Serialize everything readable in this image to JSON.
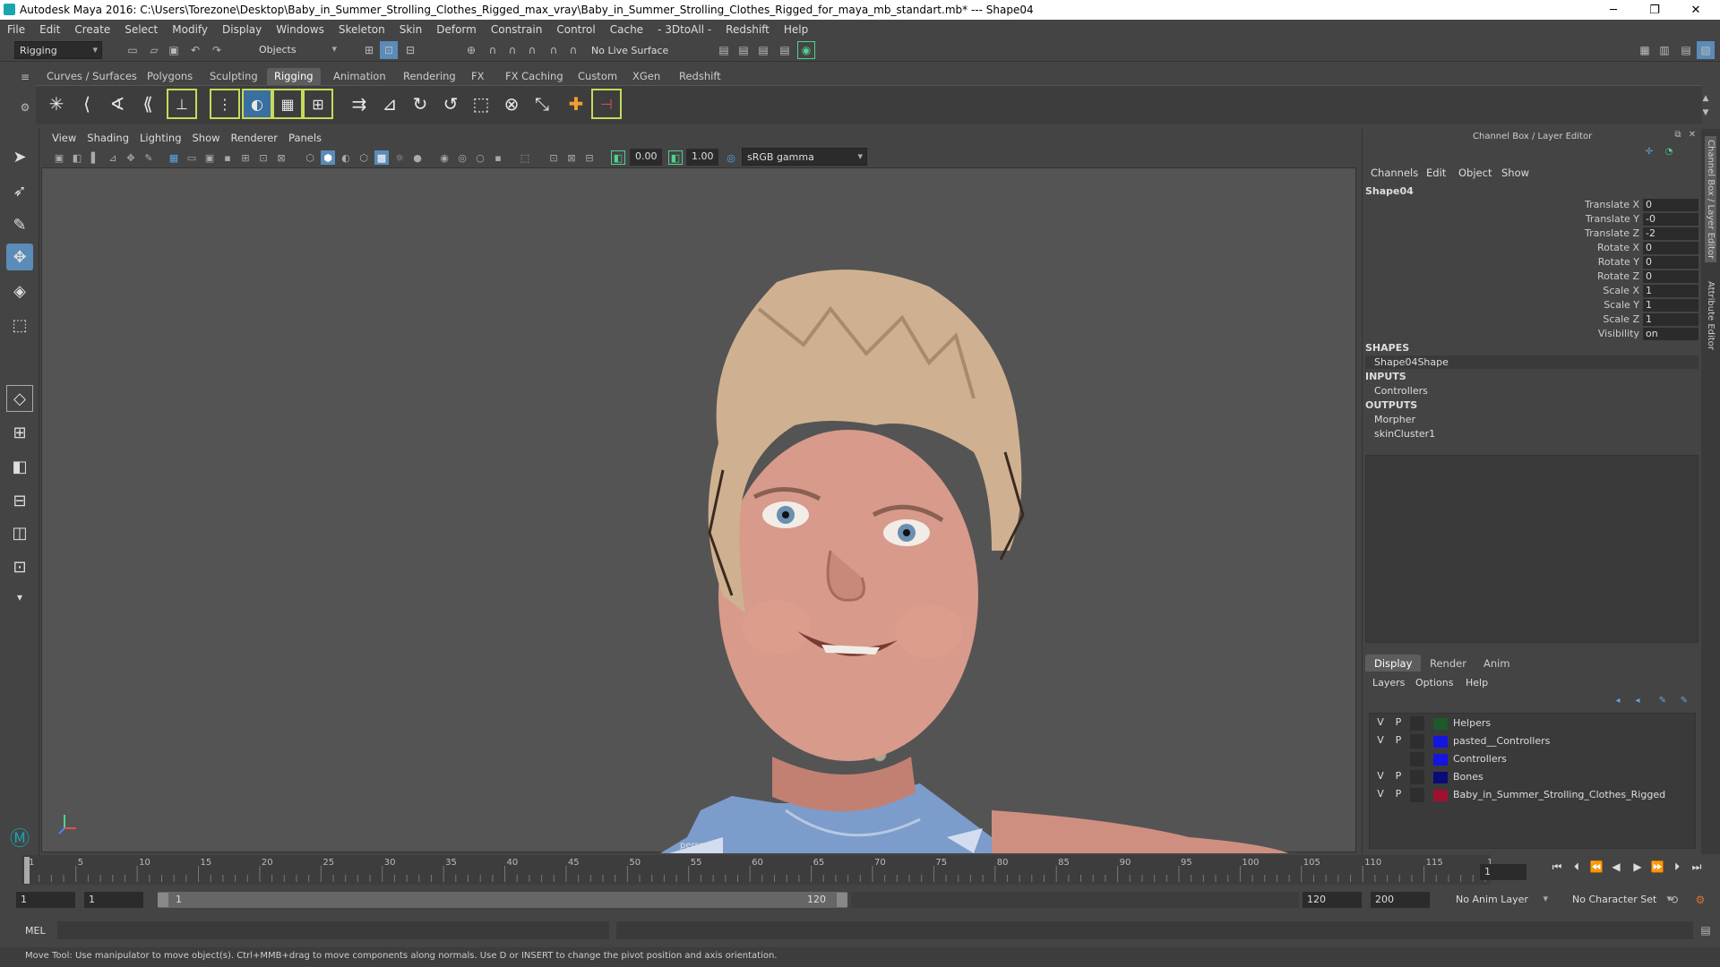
{
  "window": {
    "title": "Autodesk Maya 2016: C:\\Users\\Torezone\\Desktop\\Baby_in_Summer_Strolling_Clothes_Rigged_max_vray\\Baby_in_Summer_Strolling_Clothes_Rigged_for_maya_mb_standart.mb*   ---   Shape04",
    "minimize": "─",
    "maximize": "❐",
    "close": "✕"
  },
  "menubar": [
    "File",
    "Edit",
    "Create",
    "Select",
    "Modify",
    "Display",
    "Windows",
    "Skeleton",
    "Skin",
    "Deform",
    "Constrain",
    "Control",
    "Cache",
    "- 3DtoAll -",
    "Redshift",
    "Help"
  ],
  "statusline": {
    "menuset": "Rigging",
    "selmode": "Objects",
    "live_surface": "No Live Surface"
  },
  "shelf": {
    "tabs": [
      "Curves / Surfaces",
      "Polygons",
      "Sculpting",
      "Rigging",
      "Animation",
      "Rendering",
      "FX",
      "FX Caching",
      "Custom",
      "XGen",
      "Redshift"
    ],
    "active_tab": "Rigging"
  },
  "viewport": {
    "menu": [
      "View",
      "Shading",
      "Lighting",
      "Show",
      "Renderer",
      "Panels"
    ],
    "exposure": "0.00",
    "gamma": "1.00",
    "color_space": "sRGB gamma",
    "hud_label": "persp"
  },
  "channel_box": {
    "title": "Channel Box / Layer Editor",
    "menu": [
      "Channels",
      "Edit",
      "Object",
      "Show"
    ],
    "object": "Shape04",
    "attributes": [
      {
        "name": "Translate X",
        "value": "0"
      },
      {
        "name": "Translate Y",
        "value": "-0"
      },
      {
        "name": "Translate Z",
        "value": "-2"
      },
      {
        "name": "Rotate X",
        "value": "0"
      },
      {
        "name": "Rotate Y",
        "value": "0"
      },
      {
        "name": "Rotate Z",
        "value": "0"
      },
      {
        "name": "Scale X",
        "value": "1"
      },
      {
        "name": "Scale Y",
        "value": "1"
      },
      {
        "name": "Scale Z",
        "value": "1"
      },
      {
        "name": "Visibility",
        "value": "on"
      }
    ],
    "shapes_header": "SHAPES",
    "shape": "Shape04Shape",
    "inputs_header": "INPUTS",
    "inputs": [
      "Controllers"
    ],
    "outputs_header": "OUTPUTS",
    "outputs": [
      "Morpher",
      "skinCluster1"
    ]
  },
  "layer_editor": {
    "tabs": [
      "Display",
      "Render",
      "Anim"
    ],
    "active_tab": "Display",
    "menu": [
      "Layers",
      "Options",
      "Help"
    ],
    "layers": [
      {
        "v": "V",
        "p": "P",
        "name": "Helpers",
        "color": "#1c5a2c"
      },
      {
        "v": "V",
        "p": "P",
        "name": "pasted__Controllers",
        "color": "#1515e0"
      },
      {
        "v": "",
        "p": "",
        "name": "Controllers",
        "color": "#1515e0"
      },
      {
        "v": "V",
        "p": "P",
        "name": "Bones",
        "color": "#0a0a7a"
      },
      {
        "v": "V",
        "p": "P",
        "name": "Baby_in_Summer_Strolling_Clothes_Rigged",
        "color": "#a01030"
      }
    ]
  },
  "side_tabs": [
    "Channel Box / Layer Editor",
    "Attribute Editor"
  ],
  "timeline": {
    "ticks": [
      "1",
      "5",
      "10",
      "15",
      "20",
      "25",
      "30",
      "35",
      "40",
      "45",
      "50",
      "55",
      "60",
      "65",
      "70",
      "75",
      "80",
      "85",
      "90",
      "95",
      "100",
      "105",
      "110",
      "115",
      "120"
    ],
    "current_frame": "1"
  },
  "range": {
    "start": "1",
    "start_inner": "1",
    "slider_start": "1",
    "slider_end": "120",
    "end_inner": "120",
    "end": "200",
    "anim_layer": "No Anim Layer",
    "char_set": "No Character Set"
  },
  "cmdline": {
    "mode": "MEL"
  },
  "helpline": "Move Tool: Use manipulator to move object(s). Ctrl+MMB+drag to move components along normals. Use D or INSERT to change the pivot position and axis orientation."
}
